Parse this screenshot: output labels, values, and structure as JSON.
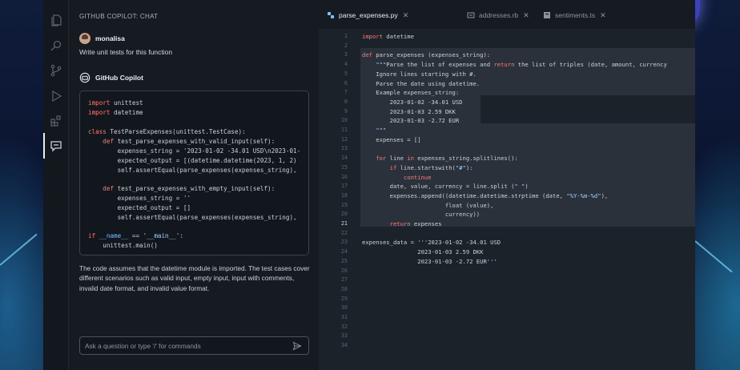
{
  "theme": {
    "accent": "#6d78ff",
    "keyword": "#ff7b72",
    "function": "#d2a8ff",
    "string": "#a5d6ff",
    "constant": "#79c0ff",
    "param": "#ffa657"
  },
  "activity_bar": {
    "icons": [
      "files-icon",
      "search-icon",
      "source-control-icon",
      "run-debug-icon",
      "extensions-icon",
      "chat-icon"
    ],
    "active": "chat-icon"
  },
  "chat": {
    "title": "GITHUB COPILOT: CHAT",
    "user_name": "monalisa",
    "user_prompt": "Write unit tests for this function",
    "bot_name": "GitHub Copilot",
    "code_lines": [
      "import unittest",
      "import datetime",
      "",
      "class TestParseExpenses(unittest.TestCase):",
      "    def test_parse_expenses_with_valid_input(self):",
      "        expenses_string = '2023-01-02 -34.01 USD\\n2023-01-",
      "        expected_output = [(datetime.datetime(2023, 1, 2)",
      "        self.assertEqual(parse_expenses(expenses_string),",
      "",
      "    def test_parse_expenses_with_empty_input(self):",
      "        expenses_string = ''",
      "        expected_output = []",
      "        self.assertEqual(parse_expenses(expenses_string),",
      "",
      "if __name__ == '__main__':",
      "    unittest.main()"
    ],
    "explanation": "The code assumes that the datetime module is imported. The test cases cover different scenarios such as valid input, empty input, input with comments, invalid date format, and invalid value format.",
    "input_placeholder": "Ask a question or type '/' for commands",
    "input_value": ""
  },
  "editor": {
    "tabs": [
      {
        "label": "parse_expenses.py",
        "icon": "python-file-icon",
        "active": true
      },
      {
        "label": "addresses.rb",
        "icon": "ruby-file-icon",
        "active": false
      },
      {
        "label": "sentiments.ts",
        "icon": "typescript-file-icon",
        "active": false
      }
    ],
    "current_line": 21,
    "line_numbers": [
      "1",
      "2",
      "3",
      "4",
      "5",
      "6",
      "7",
      "8",
      "9",
      "10",
      "11",
      "12",
      "13",
      "14",
      "15",
      "16",
      "17",
      "18",
      "19",
      "20",
      "21",
      "22",
      "23",
      "24",
      "25",
      "26",
      "27",
      "28",
      "29",
      "30",
      "31",
      "32",
      "33",
      "34"
    ],
    "lines": [
      "import datetime",
      "",
      "def parse_expenses (expenses_string):",
      "    \"\"\"Parse the list of expenses and return the list of triples (date, amount, currency",
      "    Ignore lines starting with #.",
      "    Parse the date using datetime.",
      "    Example expenses_string:",
      "        2023-01-02 -34.01 USD",
      "        2023-01-03 2.59 DKK",
      "        2023-01-03 -2.72 EUR",
      "    \"\"\"",
      "    expenses = []",
      "",
      "    for line in expenses_string.splitlines():",
      "        if line.startswith(\"#\"):",
      "            continue",
      "        date, value, currency = line.split (\" \")",
      "        expenses.append((datetime.datetime.strptime (date, \"%Y-%m-%d\"),",
      "                        float (value),",
      "                        currency))",
      "        return expenses",
      "",
      "expenses_data = '''2023-01-02 -34.01 USD",
      "                2023-01-03 2.59 DKK",
      "                2023-01-03 -2.72 EUR'''",
      "",
      "",
      "",
      "",
      "",
      "",
      "",
      "",
      ""
    ]
  }
}
